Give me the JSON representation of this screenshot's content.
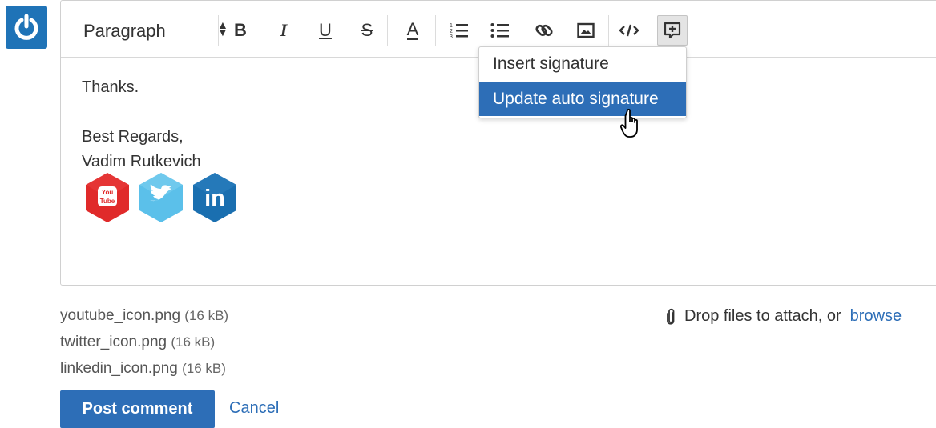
{
  "avatar": {
    "icon": "power-icon",
    "color": "#1f73b7"
  },
  "toolbar": {
    "paragraph_label": "Paragraph",
    "bold_label": "B",
    "italic_label": "I",
    "underline_label": "U",
    "strike_label": "S",
    "font_color_label": "A",
    "icons": [
      "numbered-list-icon",
      "bulleted-list-icon",
      "link-icon",
      "image-icon",
      "code-icon",
      "signature-icon"
    ],
    "font_color_accent": "#333333"
  },
  "editor": {
    "lines": [
      "Thanks.",
      "Best Regards,",
      "Vadim Rutkevich"
    ],
    "social_icons": [
      {
        "name": "youtube-icon",
        "text": "You Tube",
        "color": "#e02a2a"
      },
      {
        "name": "twitter-icon",
        "color": "#5bc0ea"
      },
      {
        "name": "linkedin-icon",
        "text": "in",
        "color": "#1a6fb0"
      }
    ]
  },
  "signature_menu": {
    "items": [
      {
        "label": "Insert signature",
        "selected": false
      },
      {
        "label": "Update auto signature",
        "selected": true
      }
    ],
    "selected_color": "#2d6eb7"
  },
  "attachments": [
    {
      "name": "youtube_icon.png",
      "size": "(16 kB)"
    },
    {
      "name": "twitter_icon.png",
      "size": "(16 kB)"
    },
    {
      "name": "linkedin_icon.png",
      "size": "(16 kB)"
    }
  ],
  "dropzone": {
    "text": "Drop files to attach, or",
    "browse_label": "browse"
  },
  "actions": {
    "post_label": "Post comment",
    "cancel_label": "Cancel"
  },
  "accent_color": "#2d6eb7"
}
